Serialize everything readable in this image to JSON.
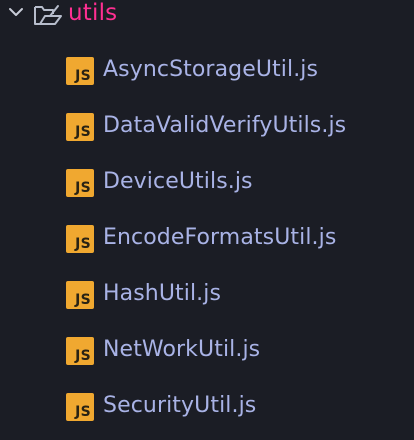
{
  "folder": {
    "name": "utils",
    "expanded": true,
    "icon": "folder-open-icon",
    "color": "#ff2f92"
  },
  "files": [
    {
      "badge": "JS",
      "name": "AsyncStorageUtil.js"
    },
    {
      "badge": "JS",
      "name": "DataValidVerifyUtils.js"
    },
    {
      "badge": "JS",
      "name": "DeviceUtils.js"
    },
    {
      "badge": "JS",
      "name": "EncodeFormatsUtil.js"
    },
    {
      "badge": "JS",
      "name": "HashUtil.js"
    },
    {
      "badge": "JS",
      "name": "NetWorkUtil.js"
    },
    {
      "badge": "JS",
      "name": "SecurityUtil.js"
    }
  ],
  "colors": {
    "background": "#1b1d25",
    "file_text": "#a9b3e6",
    "js_badge": "#f0a830"
  }
}
